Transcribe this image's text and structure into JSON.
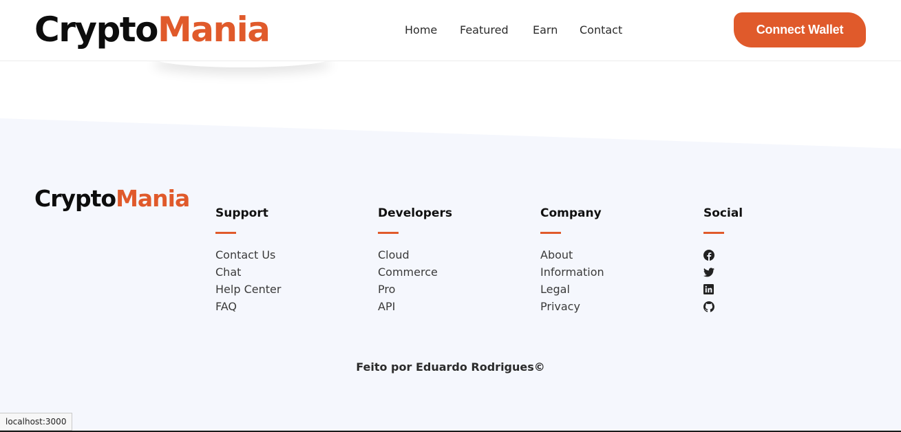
{
  "header": {
    "logo_part1": "Crypto",
    "logo_part2": "Mania",
    "nav": [
      {
        "label": "Home"
      },
      {
        "label": "Featured"
      },
      {
        "label": "Earn"
      },
      {
        "label": "Contact"
      }
    ],
    "connect_label": "Connect Wallet"
  },
  "footer": {
    "logo_part1": "Crypto",
    "logo_part2": "Mania",
    "columns": [
      {
        "title": "Support",
        "links": [
          "Contact Us",
          "Chat",
          "Help Center",
          "FAQ"
        ]
      },
      {
        "title": "Developers",
        "links": [
          "Cloud",
          "Commerce",
          "Pro",
          "API"
        ]
      },
      {
        "title": "Company",
        "links": [
          "About",
          "Information",
          "Legal",
          "Privacy"
        ]
      },
      {
        "title": "Social",
        "icons": [
          "facebook-icon",
          "twitter-icon",
          "linkedin-icon",
          "github-icon"
        ]
      }
    ],
    "credit": "Feito por Eduardo Rodrigues©"
  },
  "status_bar": {
    "url": "localhost:3000"
  },
  "colors": {
    "accent": "#e05a2b",
    "footer_bg": "#f5f7fd",
    "text_dark": "#111111"
  }
}
